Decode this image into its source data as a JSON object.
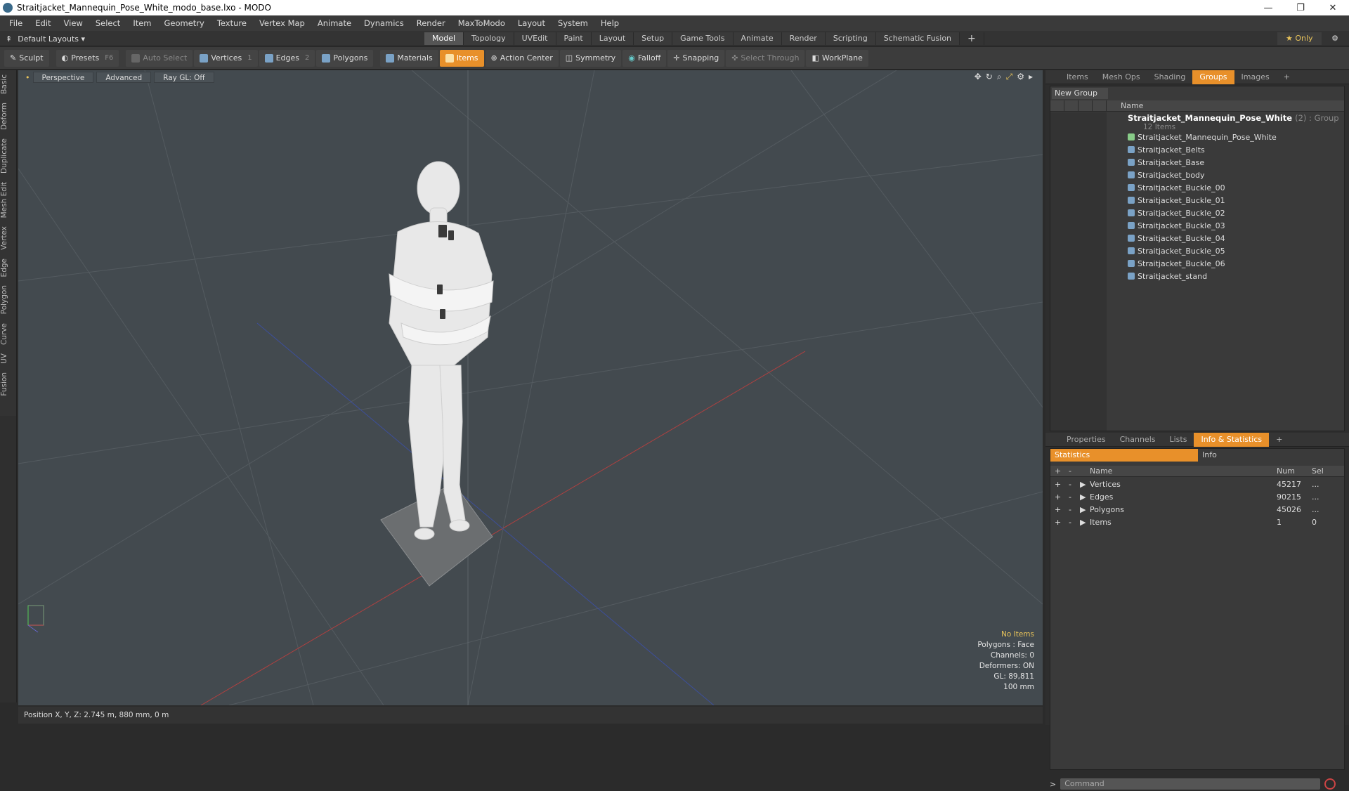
{
  "window": {
    "title": "Straitjacket_Mannequin_Pose_White_modo_base.lxo - MODO"
  },
  "menu": [
    "File",
    "Edit",
    "View",
    "Select",
    "Item",
    "Geometry",
    "Texture",
    "Vertex Map",
    "Animate",
    "Dynamics",
    "Render",
    "MaxToModo",
    "Layout",
    "System",
    "Help"
  ],
  "layouts": {
    "label": "Default Layouts ▾"
  },
  "mode_tabs": [
    "Model",
    "Topology",
    "UVEdit",
    "Paint",
    "Layout",
    "Setup",
    "Game Tools",
    "Animate",
    "Render",
    "Scripting",
    "Schematic Fusion"
  ],
  "mode_tab_active": "Model",
  "only_label": "Only",
  "toolbar": {
    "sculpt": "Sculpt",
    "presets": "Presets",
    "presets_key": "F6",
    "auto_select": "Auto Select",
    "vertices": "Vertices",
    "vertices_key": "1",
    "edges": "Edges",
    "edges_key": "2",
    "polygons": "Polygons",
    "materials": "Materials",
    "items": "Items",
    "action_center": "Action Center",
    "symmetry": "Symmetry",
    "falloff": "Falloff",
    "snapping": "Snapping",
    "select_through": "Select Through",
    "workplane": "WorkPlane"
  },
  "left_tabs": [
    "Basic",
    "Deform",
    "Duplicate",
    "Mesh Edit",
    "Vertex",
    "Edge",
    "Polygon",
    "Curve",
    "UV",
    "Fusion"
  ],
  "viewport": {
    "perspective": "Perspective",
    "advanced": "Advanced",
    "raygl": "Ray GL: Off",
    "info": {
      "no_items": "No Items",
      "polygons": "Polygons : Face",
      "channels": "Channels: 0",
      "deformers": "Deformers: ON",
      "gl": "GL: 89,811",
      "scale": "100 mm"
    }
  },
  "status": {
    "position": "Position X, Y, Z:  2.745 m, 880 mm, 0 m"
  },
  "groups_panel": {
    "tabs": [
      "Items",
      "Mesh Ops",
      "Shading",
      "Groups",
      "Images"
    ],
    "active_tab": "Groups",
    "new_group": "New Group",
    "name_header": "Name",
    "root_name": "Straitjacket_Mannequin_Pose_White",
    "root_suffix": "(2) : Group",
    "root_count": "12 Items",
    "items": [
      "Straitjacket_Mannequin_Pose_White",
      "Straitjacket_Belts",
      "Straitjacket_Base",
      "Straitjacket_body",
      "Straitjacket_Buckle_00",
      "Straitjacket_Buckle_01",
      "Straitjacket_Buckle_02",
      "Straitjacket_Buckle_03",
      "Straitjacket_Buckle_04",
      "Straitjacket_Buckle_05",
      "Straitjacket_Buckle_06",
      "Straitjacket_stand"
    ]
  },
  "stats_panel": {
    "tabs": [
      "Properties",
      "Channels",
      "Lists",
      "Info & Statistics"
    ],
    "active_tab": "Info & Statistics",
    "sub_tabs": [
      "Statistics",
      "Info"
    ],
    "headers": {
      "name": "Name",
      "num": "Num",
      "sel": "Sel"
    },
    "rows": [
      {
        "name": "Vertices",
        "num": "45217",
        "sel": "..."
      },
      {
        "name": "Edges",
        "num": "90215",
        "sel": "..."
      },
      {
        "name": "Polygons",
        "num": "45026",
        "sel": "..."
      },
      {
        "name": "Items",
        "num": "1",
        "sel": "0"
      }
    ]
  },
  "command": {
    "placeholder": "Command"
  },
  "colors": {
    "accent": "#e8902a",
    "viewport_bg": "#434a4f",
    "highlight_text": "#e8c35a"
  }
}
